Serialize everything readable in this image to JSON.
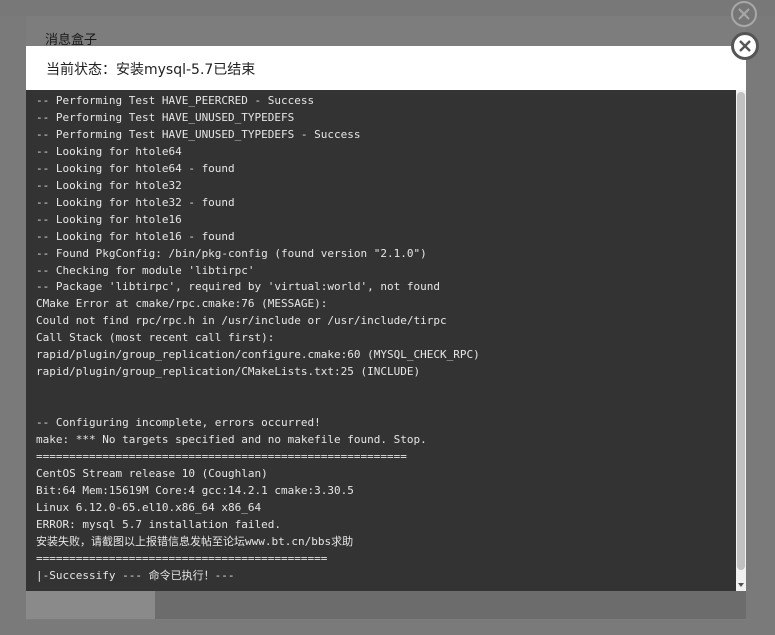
{
  "background_dialog": {
    "title": "消息盒子"
  },
  "dialog": {
    "status_text": "当前状态：安装mysql-5.7已结束",
    "close_icon": "close-icon"
  },
  "terminal": {
    "lines": [
      "-- Performing Test HAVE_PEERCRED - Success",
      "-- Performing Test HAVE_UNUSED_TYPEDEFS",
      "-- Performing Test HAVE_UNUSED_TYPEDEFS - Success",
      "-- Looking for htole64",
      "-- Looking for htole64 - found",
      "-- Looking for htole32",
      "-- Looking for htole32 - found",
      "-- Looking for htole16",
      "-- Looking for htole16 - found",
      "-- Found PkgConfig: /bin/pkg-config (found version \"2.1.0\")",
      "-- Checking for module 'libtirpc'",
      "-- Package 'libtirpc', required by 'virtual:world', not found",
      "CMake Error at cmake/rpc.cmake:76 (MESSAGE):",
      "Could not find rpc/rpc.h in /usr/include or /usr/include/tirpc",
      "Call Stack (most recent call first):",
      "rapid/plugin/group_replication/configure.cmake:60 (MYSQL_CHECK_RPC)",
      "rapid/plugin/group_replication/CMakeLists.txt:25 (INCLUDE)",
      "",
      "",
      "-- Configuring incomplete, errors occurred!",
      "make: *** No targets specified and no makefile found. Stop.",
      "========================================================",
      "CentOS Stream release 10 (Coughlan)",
      "Bit:64 Mem:15619M Core:4 gcc:14.2.1 cmake:3.30.5",
      "Linux 6.12.0-65.el10.x86_64 x86_64",
      "ERROR: mysql 5.7 installation failed.",
      "安装失败，请截图以上报错信息发帖至论坛www.bt.cn/bbs求助",
      "============================================",
      "|-Successify --- 命令已执行！---"
    ]
  },
  "colors": {
    "terminal_bg": "#333333",
    "terminal_text": "#e6e6e6",
    "overlay": "#7a7a7a"
  }
}
